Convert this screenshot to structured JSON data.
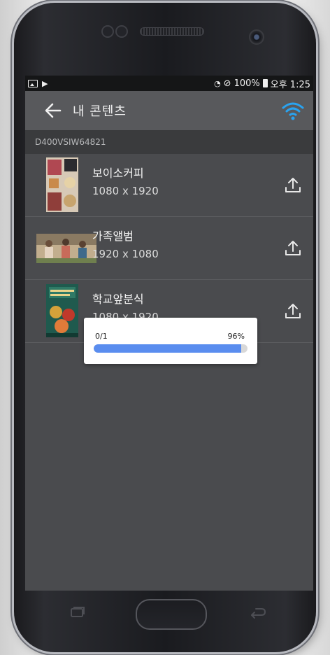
{
  "status_bar": {
    "battery": "100%",
    "time": "오후 1:25"
  },
  "app_bar": {
    "title": "내 콘텐츠",
    "wifi_color": "#29a3f0"
  },
  "device": {
    "serial": "D400VSIW64821"
  },
  "contents": [
    {
      "name": "보이소커피",
      "resolution": "1080 x 1920",
      "thumb_icon": "portrait-poster-thumbnail"
    },
    {
      "name": "가족앨범",
      "resolution": "1920 x 1080",
      "thumb_icon": "family-photo-thumbnail"
    },
    {
      "name": "학교앞분식",
      "resolution": "1080 x 1920",
      "thumb_icon": "food-poster-thumbnail"
    }
  ],
  "upload_dialog": {
    "count": "0/1",
    "percent_label": "96%",
    "progress": 0.96,
    "bar_color": "#5a8def"
  }
}
